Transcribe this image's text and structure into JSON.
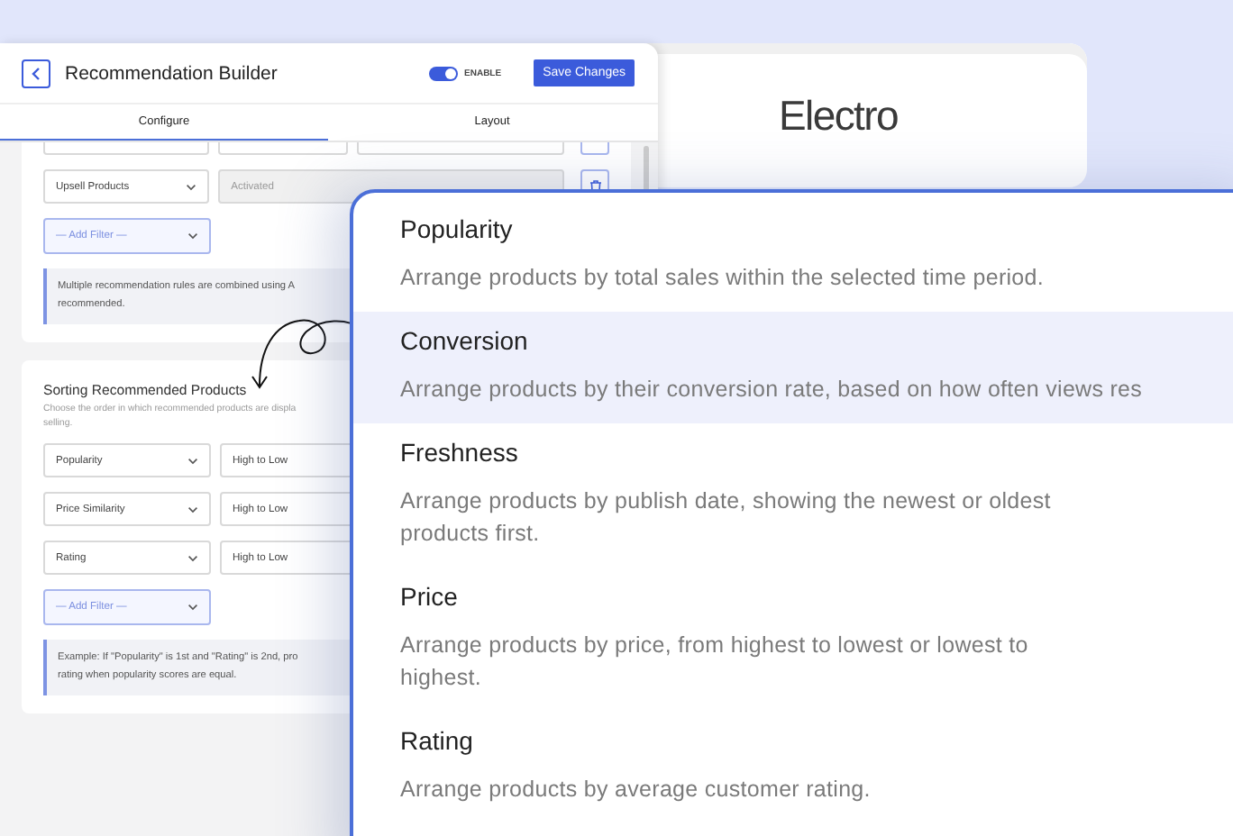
{
  "builder": {
    "title": "Recommendation Builder",
    "enable": {
      "label": "ENABLE",
      "on": true
    },
    "save_button": "Save Changes",
    "tabs": [
      {
        "label": "Configure",
        "selected": true
      },
      {
        "label": "Layout",
        "selected": false
      }
    ],
    "filter_rule": {
      "field": "Upsell Products",
      "value": "Activated",
      "disabled": true
    },
    "add_filter": "— Add Filter —",
    "rules_note": [
      "Multiple recommendation rules are combined using A",
      "recommended."
    ],
    "sorting": {
      "title": "Sorting Recommended Products",
      "description": [
        "Choose the order in which recommended products are displa",
        "selling."
      ],
      "rows": [
        {
          "field": "Popularity",
          "order": "High to Low"
        },
        {
          "field": "Price Similarity",
          "order": "High to Low"
        },
        {
          "field": "Rating",
          "order": "High to Low"
        }
      ],
      "add_filter": "— Add Filter —",
      "example": [
        "Example: If \"Popularity\" is 1st and \"Rating\" is 2nd, pro",
        "rating when popularity scores are equal."
      ]
    }
  },
  "preview": {
    "brand": "Electro"
  },
  "sort_options": [
    {
      "title": "Popularity",
      "description": [
        "Arrange products by total sales within the selected time period."
      ],
      "selected": false
    },
    {
      "title": "Conversion",
      "description": [
        "Arrange products by their conversion rate, based on how often views res"
      ],
      "selected": true
    },
    {
      "title": "Freshness",
      "description": [
        "Arrange products by publish date, showing the newest or oldest",
        "products first."
      ],
      "selected": false
    },
    {
      "title": "Price",
      "description": [
        "Arrange products by price, from highest to lowest or lowest to",
        "highest."
      ],
      "selected": false
    },
    {
      "title": "Rating",
      "description": [
        "Arrange products by average customer rating."
      ],
      "selected": false
    }
  ]
}
